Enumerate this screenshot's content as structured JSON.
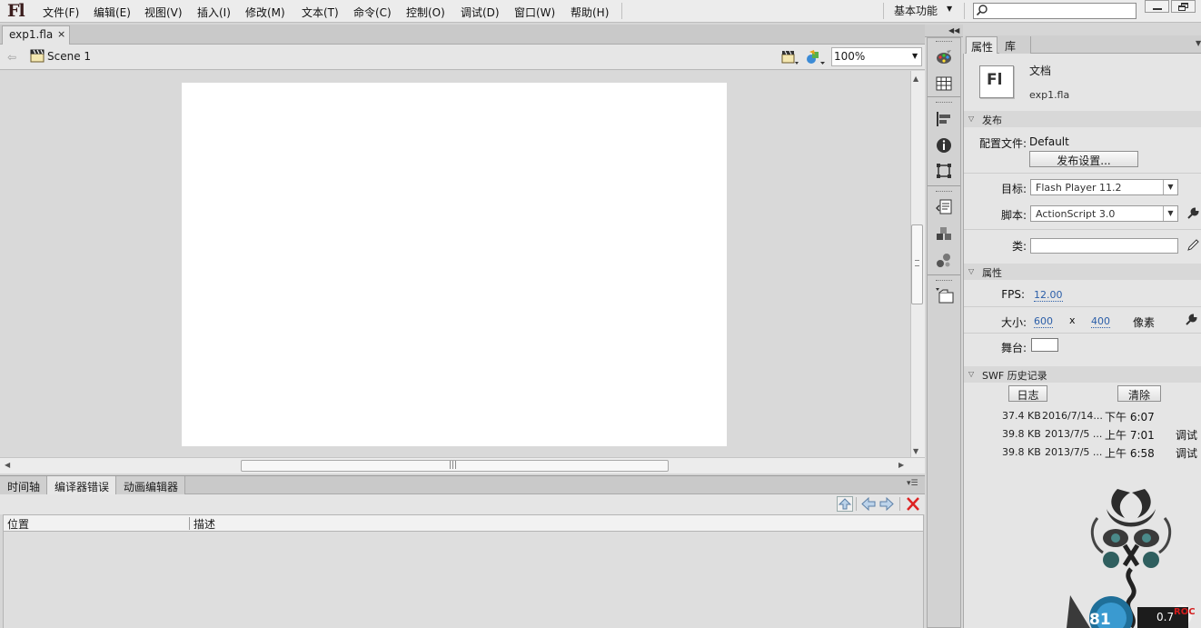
{
  "app": {
    "logo": "Fl"
  },
  "menu": [
    "文件(F)",
    "编辑(E)",
    "视图(V)",
    "插入(I)",
    "修改(M)",
    "文本(T)",
    "命令(C)",
    "控制(O)",
    "调试(D)",
    "窗口(W)",
    "帮助(H)"
  ],
  "workspace": {
    "label": "基本功能"
  },
  "search": {
    "placeholder": ""
  },
  "document": {
    "tab_label": "exp1.fla",
    "close_glyph": "×"
  },
  "scene": {
    "label": "Scene 1",
    "zoom": "100%"
  },
  "stage": {
    "width": 600,
    "height": 400,
    "color": "#ffffff"
  },
  "bottom_panel": {
    "tabs": [
      "时间轴",
      "编译器错误",
      "动画编辑器"
    ],
    "active_tab": "编译器错误",
    "columns": [
      "位置",
      "描述"
    ]
  },
  "properties": {
    "tabs": [
      "属性",
      "库"
    ],
    "doc_icon_text": "Fl",
    "doc_type": "文档",
    "doc_name": "exp1.fla",
    "publish": {
      "title": "发布",
      "profile_label": "配置文件:",
      "profile_value": "Default",
      "settings_button": "发布设置...",
      "target_label": "目标:",
      "target_value": "Flash Player 11.2",
      "script_label": "脚本:",
      "script_value": "ActionScript 3.0",
      "class_label": "类:",
      "class_value": ""
    },
    "props": {
      "title": "属性",
      "fps_label": "FPS:",
      "fps_value": "12.00",
      "size_label": "大小:",
      "width": "600",
      "x": "x",
      "height": "400",
      "unit": "像素",
      "stage_label": "舞台:",
      "stage_color": "#ffffff"
    },
    "swf_history": {
      "title": "SWF 历史记录",
      "log_button": "日志",
      "clear_button": "清除",
      "entries": [
        {
          "size": "37.4 KB",
          "date": "2016/7/14...",
          "time": "下午 6:07",
          "tag": ""
        },
        {
          "size": "39.8 KB",
          "date": "2013/7/5 ...",
          "time": "上午 7:01",
          "tag": "调试"
        },
        {
          "size": "39.8 KB",
          "date": "2013/7/5 ...",
          "time": "上午 6:58",
          "tag": "调试"
        }
      ]
    }
  },
  "overlay": {
    "left_text": "81",
    "right_text": "0.7",
    "right_badge": "ROC"
  }
}
